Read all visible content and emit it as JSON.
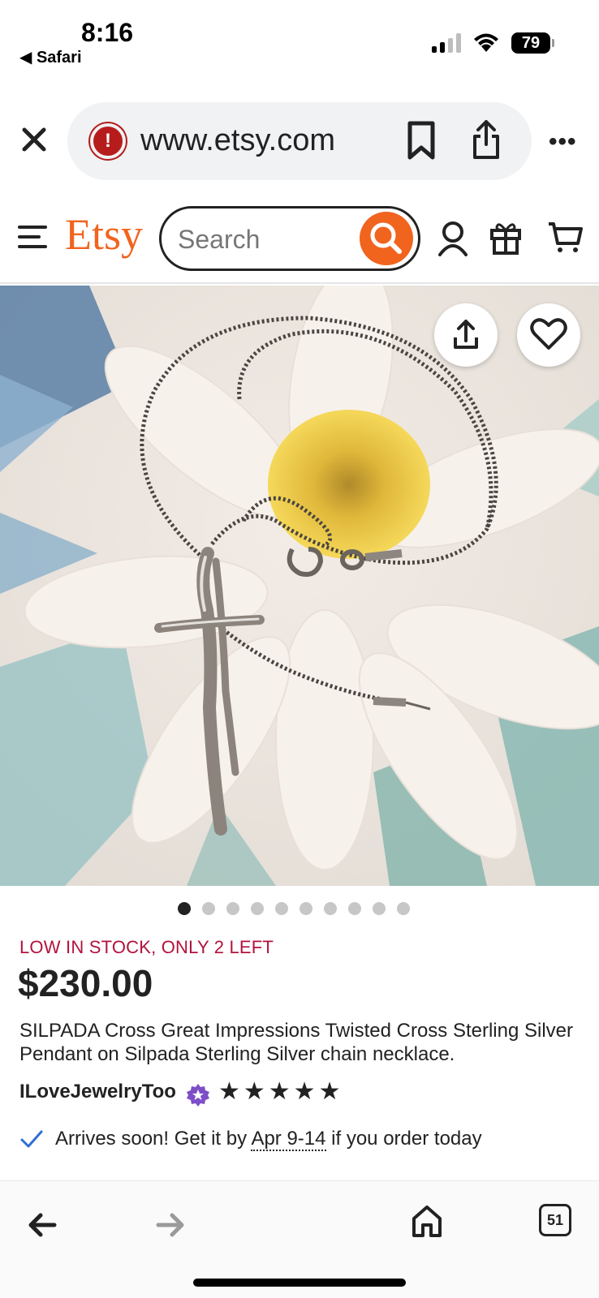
{
  "status_bar": {
    "time": "8:16",
    "back_app": "◀ Safari",
    "battery": "79"
  },
  "browser": {
    "url": "www.etsy.com",
    "more_label": "•••"
  },
  "etsy_header": {
    "logo": "Etsy",
    "search_placeholder": "Search",
    "brand_color": "#f1641e"
  },
  "product": {
    "image_count": 10,
    "active_image": 1,
    "stock_notice": "LOW IN STOCK, ONLY 2 LEFT",
    "price": "$230.00",
    "title": "SILPADA Cross Great Impressions Twisted Cross Sterling Silver Pendant on Silpada Sterling Silver chain necklace.",
    "seller": "ILoveJewelryToo",
    "rating_stars": 5,
    "delivery_prefix": "Arrives soon! Get it by ",
    "delivery_date": "Apr 9-14",
    "delivery_suffix": " if you order today"
  },
  "bottom_nav": {
    "tab_count": "51"
  }
}
